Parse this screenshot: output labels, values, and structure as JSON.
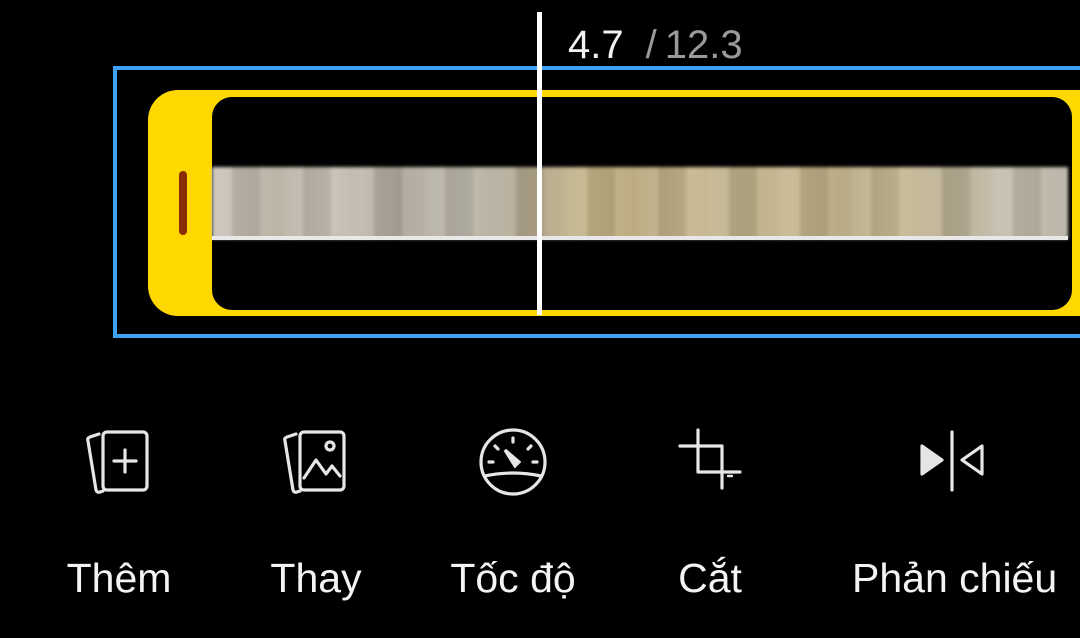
{
  "timeline": {
    "current_time": "4.7",
    "separator": "/",
    "total_time": "12.3"
  },
  "colors": {
    "selection": "#3da2f5",
    "trimmer": "#fed800",
    "handle_grip": "#8a2d00",
    "playhead": "#ffffff"
  },
  "toolbar": {
    "items": [
      {
        "label": "Thêm",
        "icon": "add-media-icon"
      },
      {
        "label": "Thay",
        "icon": "replace-image-icon"
      },
      {
        "label": "Tốc độ",
        "icon": "speed-gauge-icon"
      },
      {
        "label": "Cắt",
        "icon": "crop-icon"
      },
      {
        "label": "Phản chiếu",
        "icon": "mirror-flip-icon"
      }
    ]
  }
}
